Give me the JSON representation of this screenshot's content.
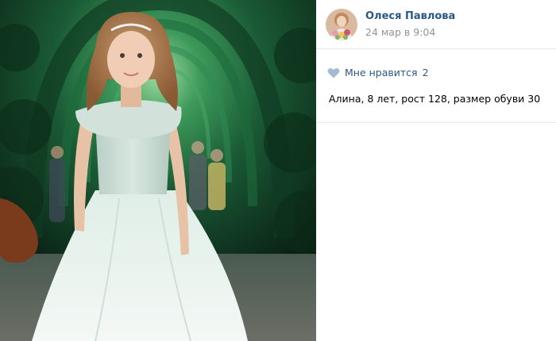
{
  "photo": {
    "alt_icon": "photo-image"
  },
  "post": {
    "author_name": "Олеся Павлова",
    "date": "24 мар в 9:04",
    "likes": {
      "label": "Мне нравится",
      "count": "2",
      "icon": "heart-icon"
    },
    "caption": "Алина, 8 лет, рост 128, размер обуви 30"
  },
  "colors": {
    "link": "#2a5885",
    "muted": "#939393",
    "heart": "#a5bad3",
    "divider": "#e7e8ec"
  }
}
